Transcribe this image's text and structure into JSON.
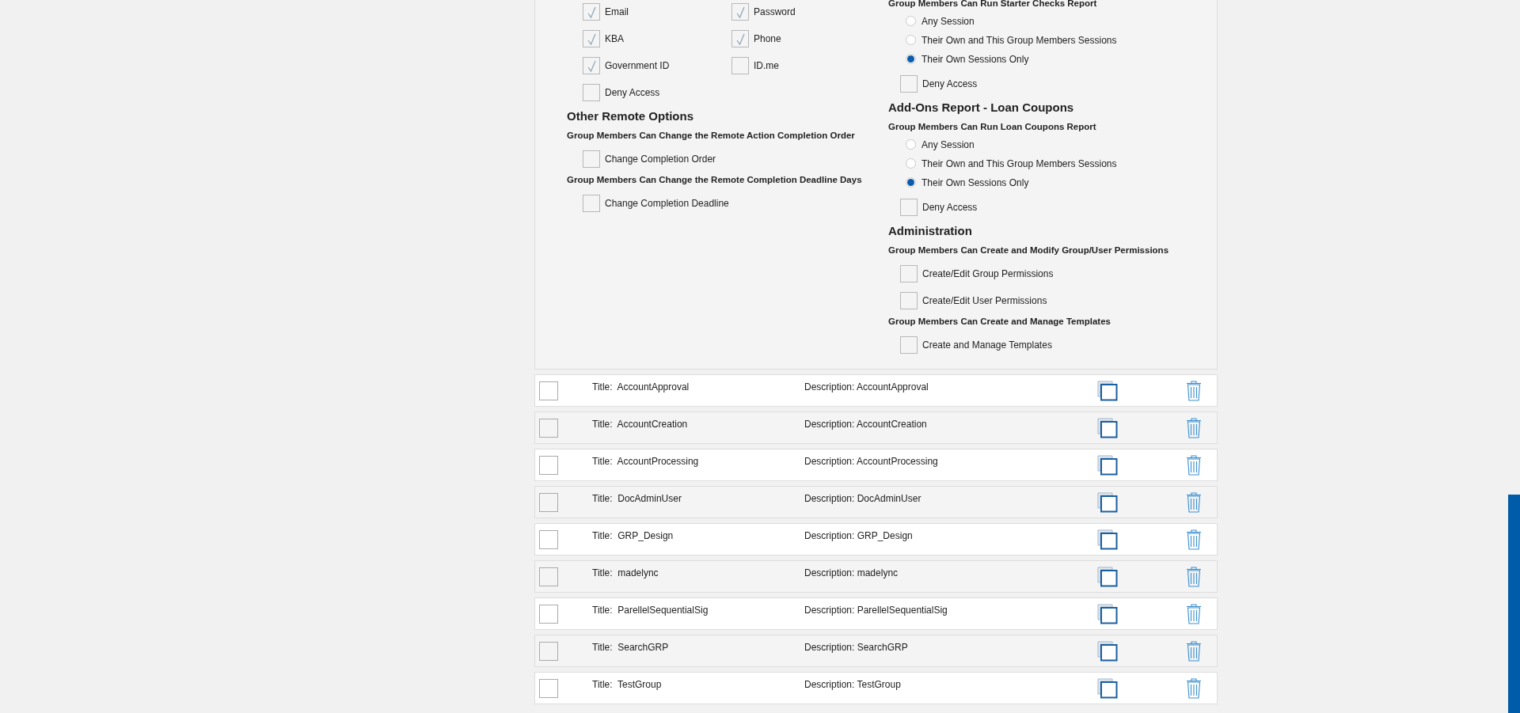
{
  "permissions_panel": {
    "columns": [
      {
        "blocks": [
          {
            "kind": "checkbox_grid",
            "items": [
              {
                "label": "Email",
                "checked": true
              },
              {
                "label": "Password",
                "checked": true
              },
              {
                "label": "KBA",
                "checked": true
              },
              {
                "label": "Phone",
                "checked": true
              },
              {
                "label": "Government ID",
                "checked": true
              },
              {
                "label": "ID.me",
                "checked": false
              }
            ]
          },
          {
            "kind": "checkbox",
            "label": "Deny Access",
            "checked": false
          },
          {
            "kind": "heading",
            "text": "Other Remote Options"
          },
          {
            "kind": "subheading",
            "text": "Group Members Can Change the Remote Action Completion Order"
          },
          {
            "kind": "checkbox",
            "label": "Change Completion Order",
            "checked": false
          },
          {
            "kind": "subheading",
            "text": "Group Members Can Change the Remote Completion Deadline Days"
          },
          {
            "kind": "checkbox",
            "label": "Change Completion Deadline",
            "checked": false
          }
        ]
      },
      {
        "blocks": [
          {
            "kind": "subheading",
            "text": "Group Members Can Run Starter Checks Report"
          },
          {
            "kind": "radio",
            "label": "Any Session",
            "selected": false
          },
          {
            "kind": "radio",
            "label": "Their Own and This Group Members Sessions",
            "selected": false
          },
          {
            "kind": "radio",
            "label": "Their Own Sessions Only",
            "selected": true
          },
          {
            "kind": "checkbox",
            "label": "Deny Access",
            "checked": false
          },
          {
            "kind": "heading",
            "text": "Add-Ons Report - Loan Coupons"
          },
          {
            "kind": "subheading",
            "text": "Group Members Can Run Loan Coupons Report"
          },
          {
            "kind": "radio",
            "label": "Any Session",
            "selected": false
          },
          {
            "kind": "radio",
            "label": "Their Own and This Group Members Sessions",
            "selected": false
          },
          {
            "kind": "radio",
            "label": "Their Own Sessions Only",
            "selected": true
          },
          {
            "kind": "checkbox",
            "label": "Deny Access",
            "checked": false
          },
          {
            "kind": "heading",
            "text": "Administration"
          },
          {
            "kind": "subheading",
            "text": "Group Members Can Create and Modify Group/User Permissions"
          },
          {
            "kind": "checkbox",
            "label": "Create/Edit Group Permissions",
            "checked": false
          },
          {
            "kind": "checkbox",
            "label": "Create/Edit User Permissions",
            "checked": false
          },
          {
            "kind": "subheading",
            "text": "Group Members Can Create and Manage Templates"
          },
          {
            "kind": "checkbox",
            "label": "Create and Manage Templates",
            "checked": false
          }
        ]
      }
    ]
  },
  "groups": [
    {
      "title_label": "Title:",
      "title": "AccountApproval",
      "checked": false,
      "description_label": "Description:",
      "description": "AccountApproval"
    },
    {
      "title_label": "Title:",
      "title": "AccountCreation",
      "checked": false,
      "description_label": "Description:",
      "description": "AccountCreation"
    },
    {
      "title_label": "Title:",
      "title": "AccountProcessing",
      "checked": false,
      "description_label": "Description:",
      "description": "AccountProcessing"
    },
    {
      "title_label": "Title:",
      "title": "DocAdminUser",
      "checked": false,
      "description_label": "Description:",
      "description": "DocAdminUser"
    },
    {
      "title_label": "Title:",
      "title": "GRP_Design",
      "checked": false,
      "description_label": "Description:",
      "description": "GRP_Design"
    },
    {
      "title_label": "Title:",
      "title": "madelync",
      "checked": false,
      "description_label": "Description:",
      "description": "madelync"
    },
    {
      "title_label": "Title:",
      "title": "ParellelSequentialSig",
      "checked": false,
      "description_label": "Description:",
      "description": "ParellelSequentialSig"
    },
    {
      "title_label": "Title:",
      "title": "SearchGRP",
      "checked": false,
      "description_label": "Description:",
      "description": "SearchGRP"
    },
    {
      "title_label": "Title:",
      "title": "TestGroup",
      "checked": false,
      "description_label": "Description:",
      "description": "TestGroup"
    }
  ]
}
